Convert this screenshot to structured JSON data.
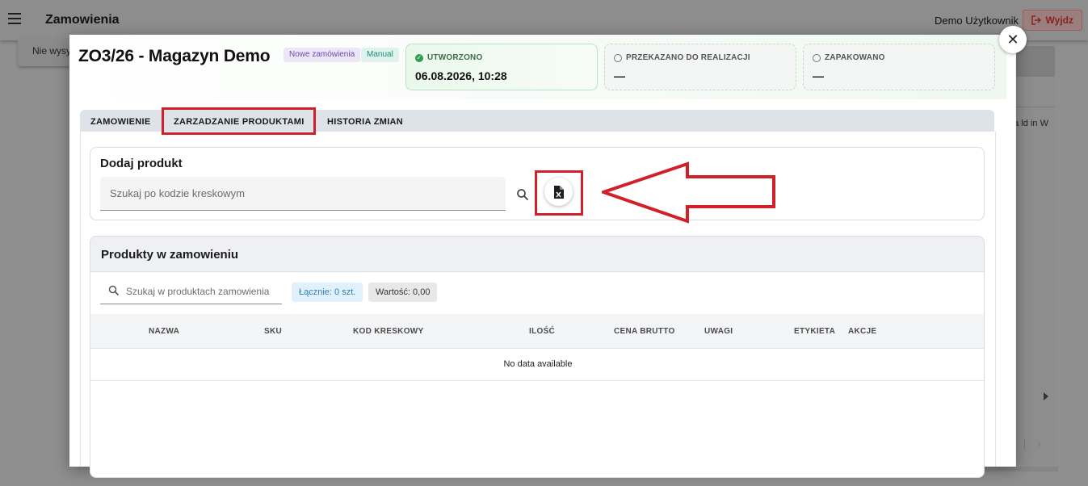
{
  "app": {
    "title": "Zamowienia",
    "user": "Demo Użytkownik",
    "logout_label": "Wyjdz",
    "bg_card_text": "Nie wysy",
    "bg_clip_text": "ma ld in W"
  },
  "modal": {
    "order_title": "ZO3/26 - Magazyn Demo",
    "chips": [
      "Nowe zamówienia",
      "Manual"
    ],
    "statuses": [
      {
        "label": "UTWORZONO",
        "value": "06.08.2026, 10:28",
        "done": true
      },
      {
        "label": "PRZEKAZANO DO REALIZACJI",
        "value": "—",
        "done": false
      },
      {
        "label": "ZAPAKOWANO",
        "value": "—",
        "done": false
      }
    ],
    "close_icon": "close-icon",
    "tabs": [
      "ZAMOWIENIE",
      "ZARZADZANIE PRODUKTAMI",
      "HISTORIA ZMIAN"
    ],
    "active_tab": "ZARZADZANIE PRODUKTAMI"
  },
  "add_product": {
    "title": "Dodaj produkt",
    "barcode_placeholder": "Szukaj po kodzie kreskowym",
    "search_icon": "search-icon",
    "import_icon": "excel-file-icon"
  },
  "products": {
    "title": "Produkty w zamowieniu",
    "filter_placeholder": "Szukaj w produktach zamowienia",
    "total_badge": "Łącznie: 0 szt.",
    "value_badge": "Wartość: 0,00",
    "columns": [
      "NAZWA",
      "SKU",
      "KOD KRESKOWY",
      "ILOŚĆ",
      "CENA BRUTTO",
      "UWAGI",
      "ETYKIETA",
      "AKCJE"
    ],
    "empty_text": "No data available"
  },
  "colors": {
    "highlight": "#d0202a",
    "success": "#2e9d4f",
    "chip_new_bg": "#ece6f6",
    "chip_manual_bg": "#dff3ee"
  }
}
